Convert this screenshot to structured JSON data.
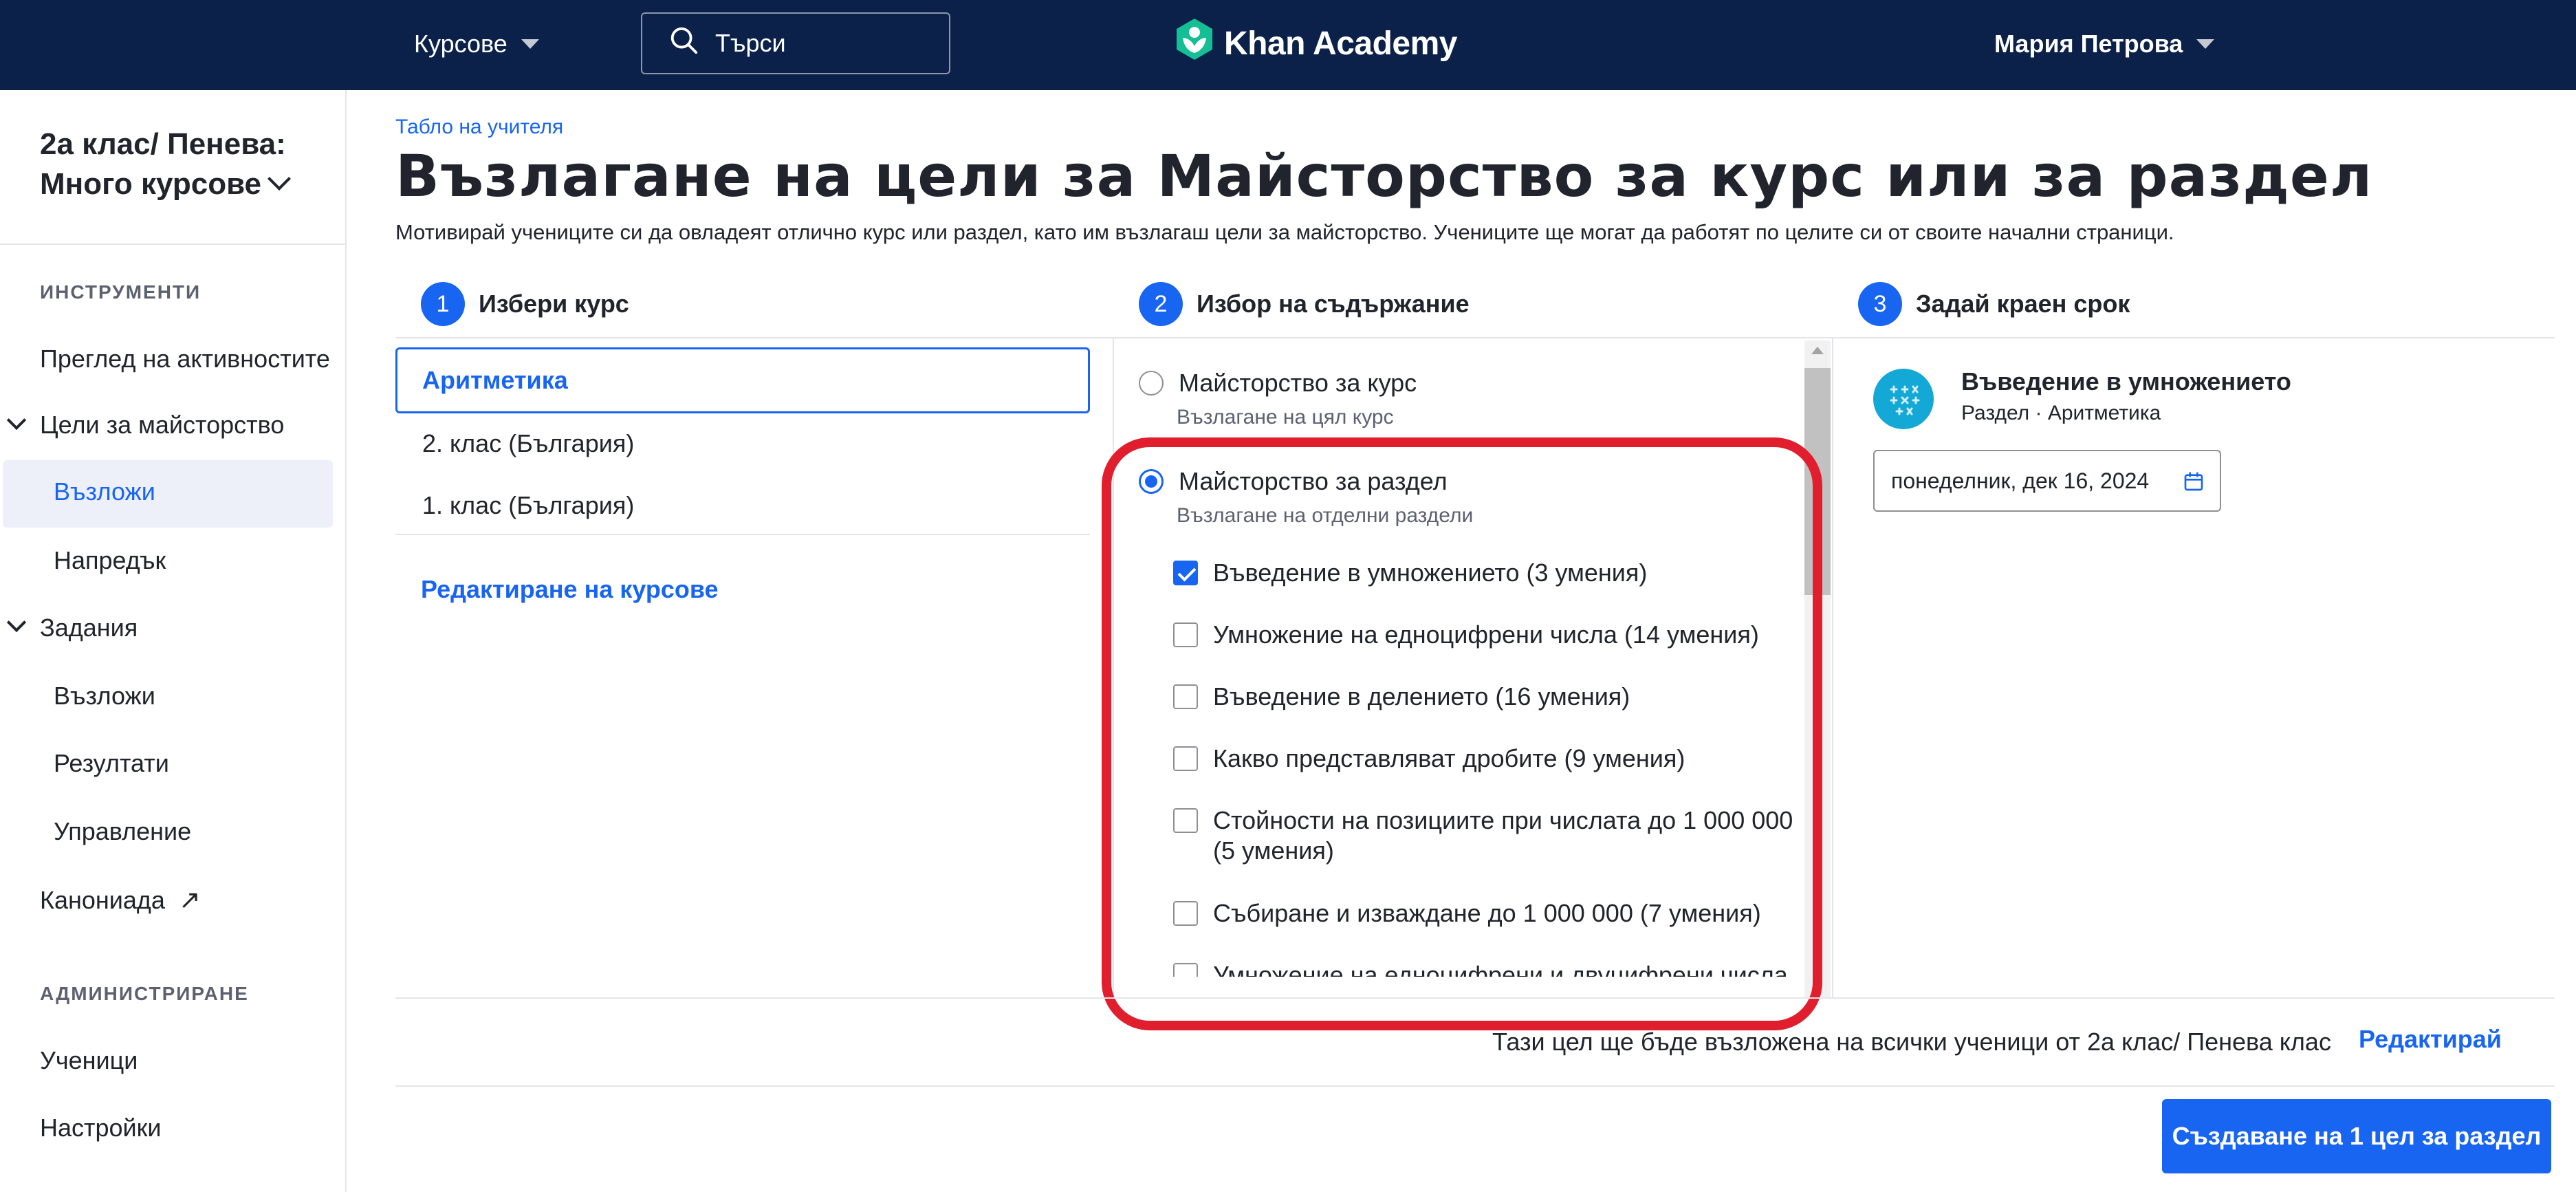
{
  "nav": {
    "courses_label": "Курсове",
    "search_placeholder": "Търси",
    "logo_text": "Khan Academy",
    "user_name": "Мария Петрова"
  },
  "sidebar": {
    "class_title": "2а клас/ Пенева: Много курсове",
    "tools_heading": "ИНСТРУМЕНТИ",
    "activity_overview": "Преглед на активностите",
    "mastery_goals": "Цели за майсторство",
    "mastery_assign": "Възложи",
    "mastery_progress": "Напредък",
    "assignments": "Задания",
    "assignments_assign": "Възложи",
    "assignments_results": "Резултати",
    "assignments_manage": "Управление",
    "canoniada": "Канониада",
    "admin_heading": "АДМИНИСТРИРАНЕ",
    "students": "Ученици",
    "settings": "Настройки"
  },
  "header": {
    "breadcrumb": "Табло на учителя",
    "title": "Възлагане на цели за Майсторство за курс или за раздел",
    "description": "Мотивирай учениците си да овладеят отлично курс или раздел, като им възлагаш цели за майсторство. Учениците ще могат да работят по целите си от своите начални страници."
  },
  "steps": [
    {
      "num": "1",
      "label": "Избери курс"
    },
    {
      "num": "2",
      "label": "Избор на съдържание"
    },
    {
      "num": "3",
      "label": "Задай краен срок"
    }
  ],
  "courses": {
    "selected": "Аритметика",
    "items": [
      "2. клас (България)",
      "1. клас (България)"
    ],
    "edit_link": "Редактиране на курсове"
  },
  "content": {
    "course_option": "Майсторство за курс",
    "course_option_sub": "Възлагане на цял курс",
    "unit_option": "Майсторство за раздел",
    "unit_option_sub": "Възлагане на отделни раздели",
    "units": [
      {
        "label": "Въведение в умножението (3 умения)",
        "checked": true
      },
      {
        "label": "Умножение на едноцифрени числа (14 умения)",
        "checked": false
      },
      {
        "label": "Въведение в делението (16 умения)",
        "checked": false
      },
      {
        "label": "Какво представляват дробите (9 умения)",
        "checked": false
      },
      {
        "label": "Стойности на позициите при числата до 1 000 000 (5 умения)",
        "checked": false
      },
      {
        "label": "Събиране и изваждане до 1 000 000 (7 умения)",
        "checked": false
      },
      {
        "label": "Умножение на едноцифрени и двуцифрени числа",
        "checked": false
      }
    ]
  },
  "deadline": {
    "unit_title": "Въведение в умножението",
    "unit_sub": "Раздел · Аритметика",
    "date_value": "понеделник, дек 16, 2024"
  },
  "footer": {
    "note": "Тази цел ще бъде възложена на всички ученици от 2а клас/ Пенева клас",
    "edit": "Редактирай",
    "create_button": "Създаване на 1 цел за раздел"
  },
  "colors": {
    "nav_bg": "#0b2149",
    "accent": "#1865f2",
    "highlight": "#e01e2d",
    "unit_icon": "#14a8d6",
    "logo_green": "#14bf96"
  }
}
